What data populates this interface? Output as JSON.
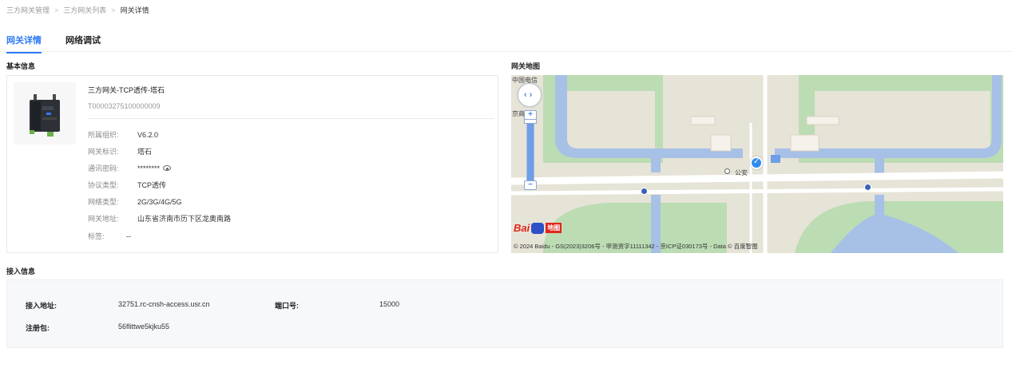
{
  "breadcrumb": {
    "items": [
      "三方网关管理",
      "三方网关列表",
      "网关详情"
    ],
    "separator": ">"
  },
  "tabs": [
    {
      "label": "网关详情",
      "active": true
    },
    {
      "label": "网络调试",
      "active": false
    }
  ],
  "colors": {
    "accent": "#2f7bf5",
    "map_water": "#a7c0e6",
    "map_green": "#bcdcb3",
    "map_land": "#e6e3d7"
  },
  "basic_info": {
    "title": "基本信息",
    "device_name": "三方网关-TCP透传-塔石",
    "serial": "T00003275100000009",
    "fields": [
      {
        "label": "所属组织:",
        "value": "V6.2.0"
      },
      {
        "label": "网关标识:",
        "value": "塔石"
      },
      {
        "label": "通讯密码:",
        "value": "********",
        "icon": "eye-icon"
      },
      {
        "label": "协议类型:",
        "value": "TCP透传"
      },
      {
        "label": "网络类型:",
        "value": "2G/3G/4G/5G"
      },
      {
        "label": "网关地址:",
        "value": "山东省济南市历下区龙奥南路"
      },
      {
        "label": "标签:",
        "value": "--"
      }
    ]
  },
  "map": {
    "title": "网关地图",
    "labels": {
      "telecom": "中国电信",
      "shop": "京商街",
      "poi": "公安"
    },
    "logo_text": "Bai",
    "logo_tag": "地图",
    "copyright": "© 2024 Baidu - GS(2023)3206号 - 甲测资字11111342 - 京ICP证030173号 - Data © 百度智图"
  },
  "access_info": {
    "title": "接入信息",
    "address_label": "接入地址:",
    "address_value": "32751.rc-cnsh-access.usr.cn",
    "port_label": "端口号:",
    "port_value": "15000",
    "register_label": "注册包:",
    "register_value": "56flittwe5kjku55"
  }
}
